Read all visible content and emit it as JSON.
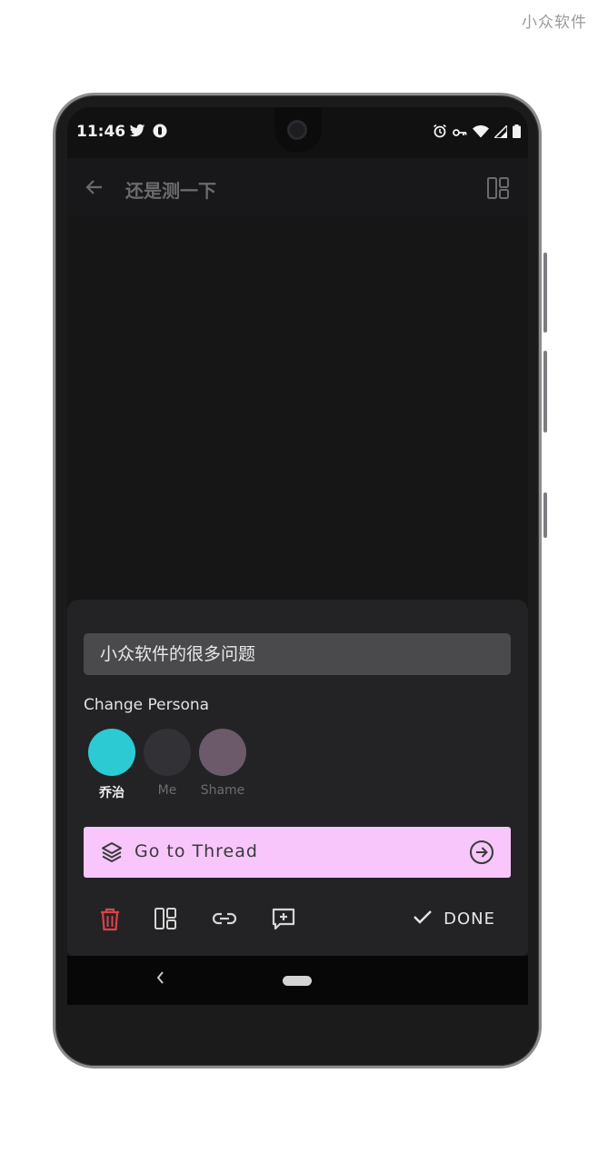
{
  "watermark": "小众软件",
  "status": {
    "time": "11:46"
  },
  "appbar": {
    "title": "还是测一下"
  },
  "editor": {
    "input_value": "小众软件的很多问题"
  },
  "persona": {
    "label": "Change Persona",
    "options": [
      {
        "name": "乔治",
        "color": "#2ccbd3",
        "selected": true
      },
      {
        "name": "Me",
        "color": "#323236",
        "selected": false
      },
      {
        "name": "Shame",
        "color": "#6c5a6b",
        "selected": false
      }
    ]
  },
  "thread_button": {
    "label": "Go to Thread"
  },
  "toolbar": {
    "done_label": "DONE"
  },
  "colors": {
    "thread_bg": "#f8c6fb",
    "delete_red": "#d9434a",
    "selected_persona": "#2ccbd3"
  }
}
